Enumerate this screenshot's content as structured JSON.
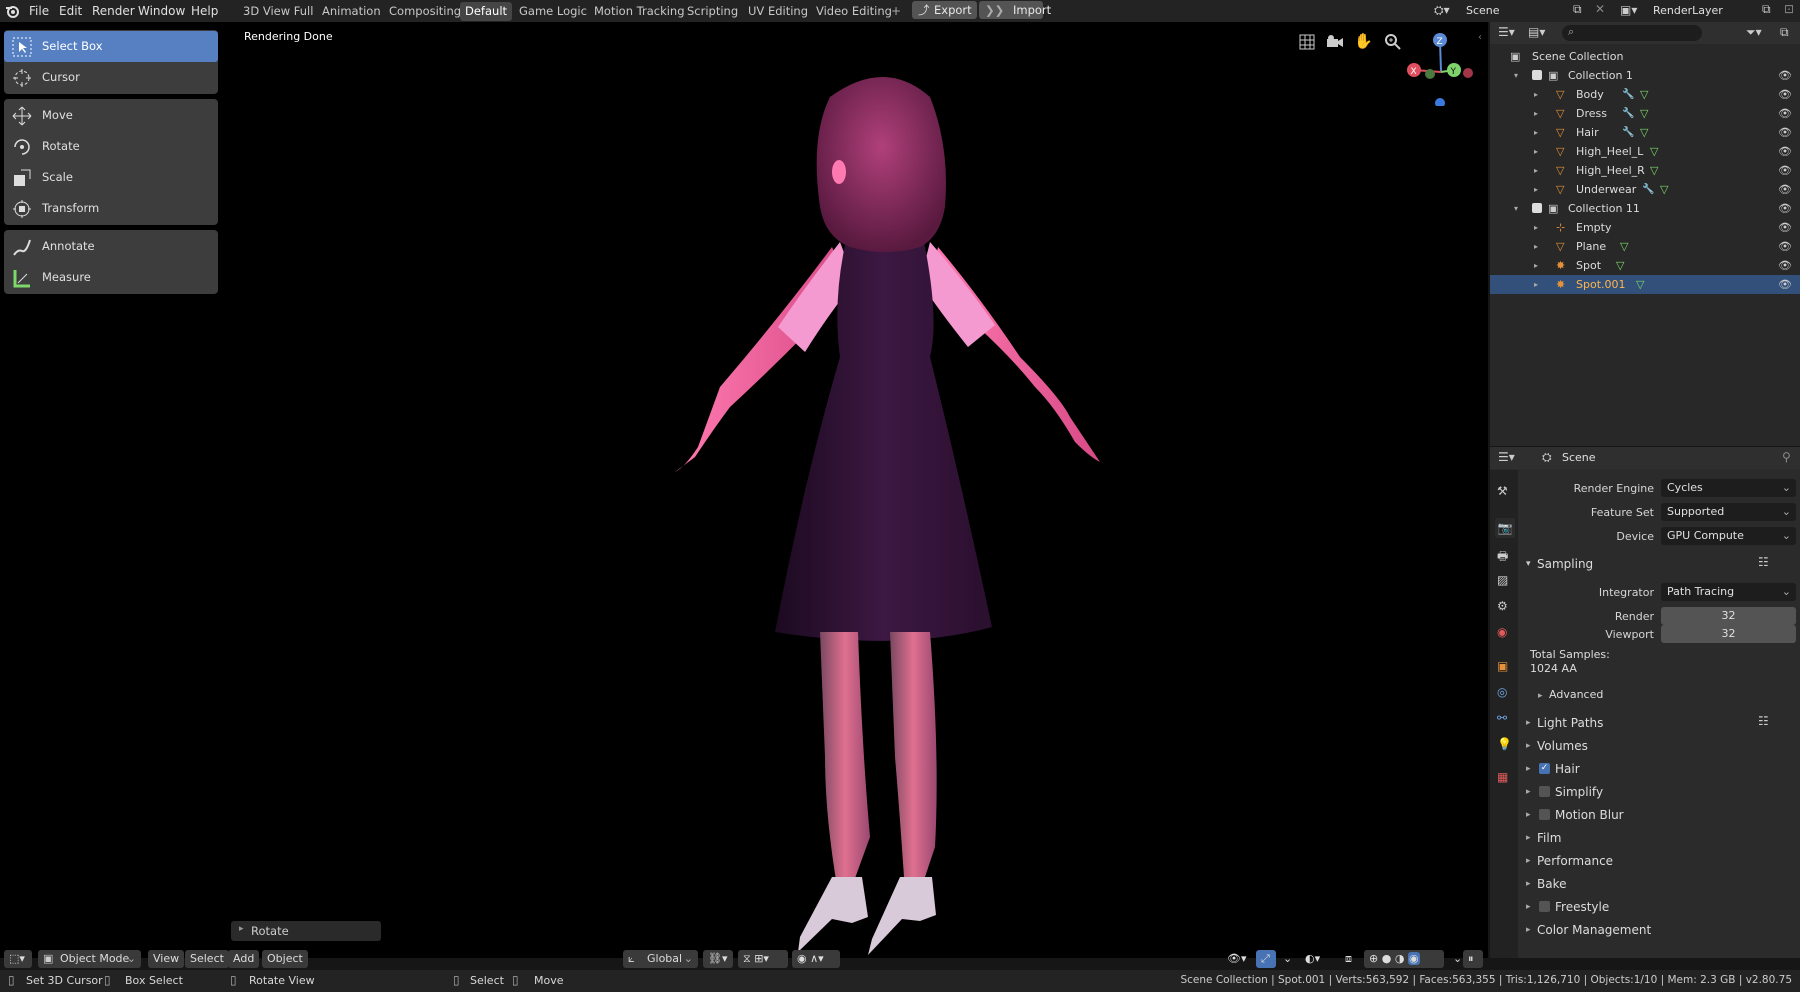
{
  "menus": [
    "File",
    "Edit",
    "Render",
    "Window",
    "Help"
  ],
  "workspaces": [
    "3D View Full",
    "Animation",
    "Compositing",
    "Default",
    "Game Logic",
    "Motion Tracking",
    "Scripting",
    "UV Editing",
    "Video Editing"
  ],
  "active_workspace": "Default",
  "export_label": "Export",
  "import_label": "Import",
  "scene_name": "Scene",
  "view_layer": "RenderLayer",
  "viewport": {
    "status": "Rendering Done",
    "last_op": "Rotate"
  },
  "tools": {
    "group1": [
      "Select Box",
      "Cursor"
    ],
    "group2": [
      "Move",
      "Rotate",
      "Scale",
      "Transform"
    ],
    "group3": [
      "Annotate",
      "Measure"
    ]
  },
  "gizmo": {
    "x": "X",
    "y": "Y",
    "z": "Z"
  },
  "outliner": {
    "root": "Scene Collection",
    "rows": [
      {
        "label": "Collection 1",
        "kind": "collection",
        "depth": 1
      },
      {
        "label": "Body",
        "kind": "mesh",
        "depth": 2
      },
      {
        "label": "Dress",
        "kind": "mesh",
        "depth": 2
      },
      {
        "label": "Hair",
        "kind": "mesh",
        "depth": 2
      },
      {
        "label": "High_Heel_L",
        "kind": "mesh",
        "depth": 2
      },
      {
        "label": "High_Heel_R",
        "kind": "mesh",
        "depth": 2
      },
      {
        "label": "Underwear",
        "kind": "mesh",
        "depth": 2
      },
      {
        "label": "Collection 11",
        "kind": "collection",
        "depth": 1
      },
      {
        "label": "Empty",
        "kind": "empty",
        "depth": 2
      },
      {
        "label": "Plane",
        "kind": "mesh",
        "depth": 2
      },
      {
        "label": "Spot",
        "kind": "light",
        "depth": 2
      },
      {
        "label": "Spot.001",
        "kind": "light",
        "depth": 2,
        "selected": true
      }
    ]
  },
  "properties": {
    "context": "Scene",
    "render_engine_label": "Render Engine",
    "render_engine": "Cycles",
    "feature_set_label": "Feature Set",
    "feature_set": "Supported",
    "device_label": "Device",
    "device": "GPU Compute",
    "sampling": "Sampling",
    "integrator_label": "Integrator",
    "integrator": "Path Tracing",
    "render_label": "Render",
    "render_samples": "32",
    "viewport_label": "Viewport",
    "viewport_samples": "32",
    "total_samples_label": "Total Samples:",
    "total_samples": "1024 AA",
    "advanced": "Advanced",
    "sections": [
      "Light Paths",
      "Volumes",
      "Hair",
      "Simplify",
      "Motion Blur",
      "Film",
      "Performance",
      "Bake",
      "Freestyle",
      "Color Management"
    ]
  },
  "header": {
    "mode": "Object Mode",
    "view": "View",
    "select": "Select",
    "add": "Add",
    "object": "Object",
    "orientation": "Global"
  },
  "status": {
    "left1": "Set 3D Cursor",
    "left2": "Box Select",
    "left3": "Rotate View",
    "mid1": "Select",
    "mid2": "Move",
    "right": "Scene Collection | Spot.001 | Verts:563,592 | Faces:563,355 | Tris:1,126,710 | Objects:1/10 | Mem: 2.3 GB | v2.80.75"
  },
  "colors": {
    "accent": "#5680c2",
    "selected_row": "#32507a",
    "mesh_icon": "#e4913a",
    "modifier": "#6fa7e8",
    "data": "#7dd86a"
  }
}
